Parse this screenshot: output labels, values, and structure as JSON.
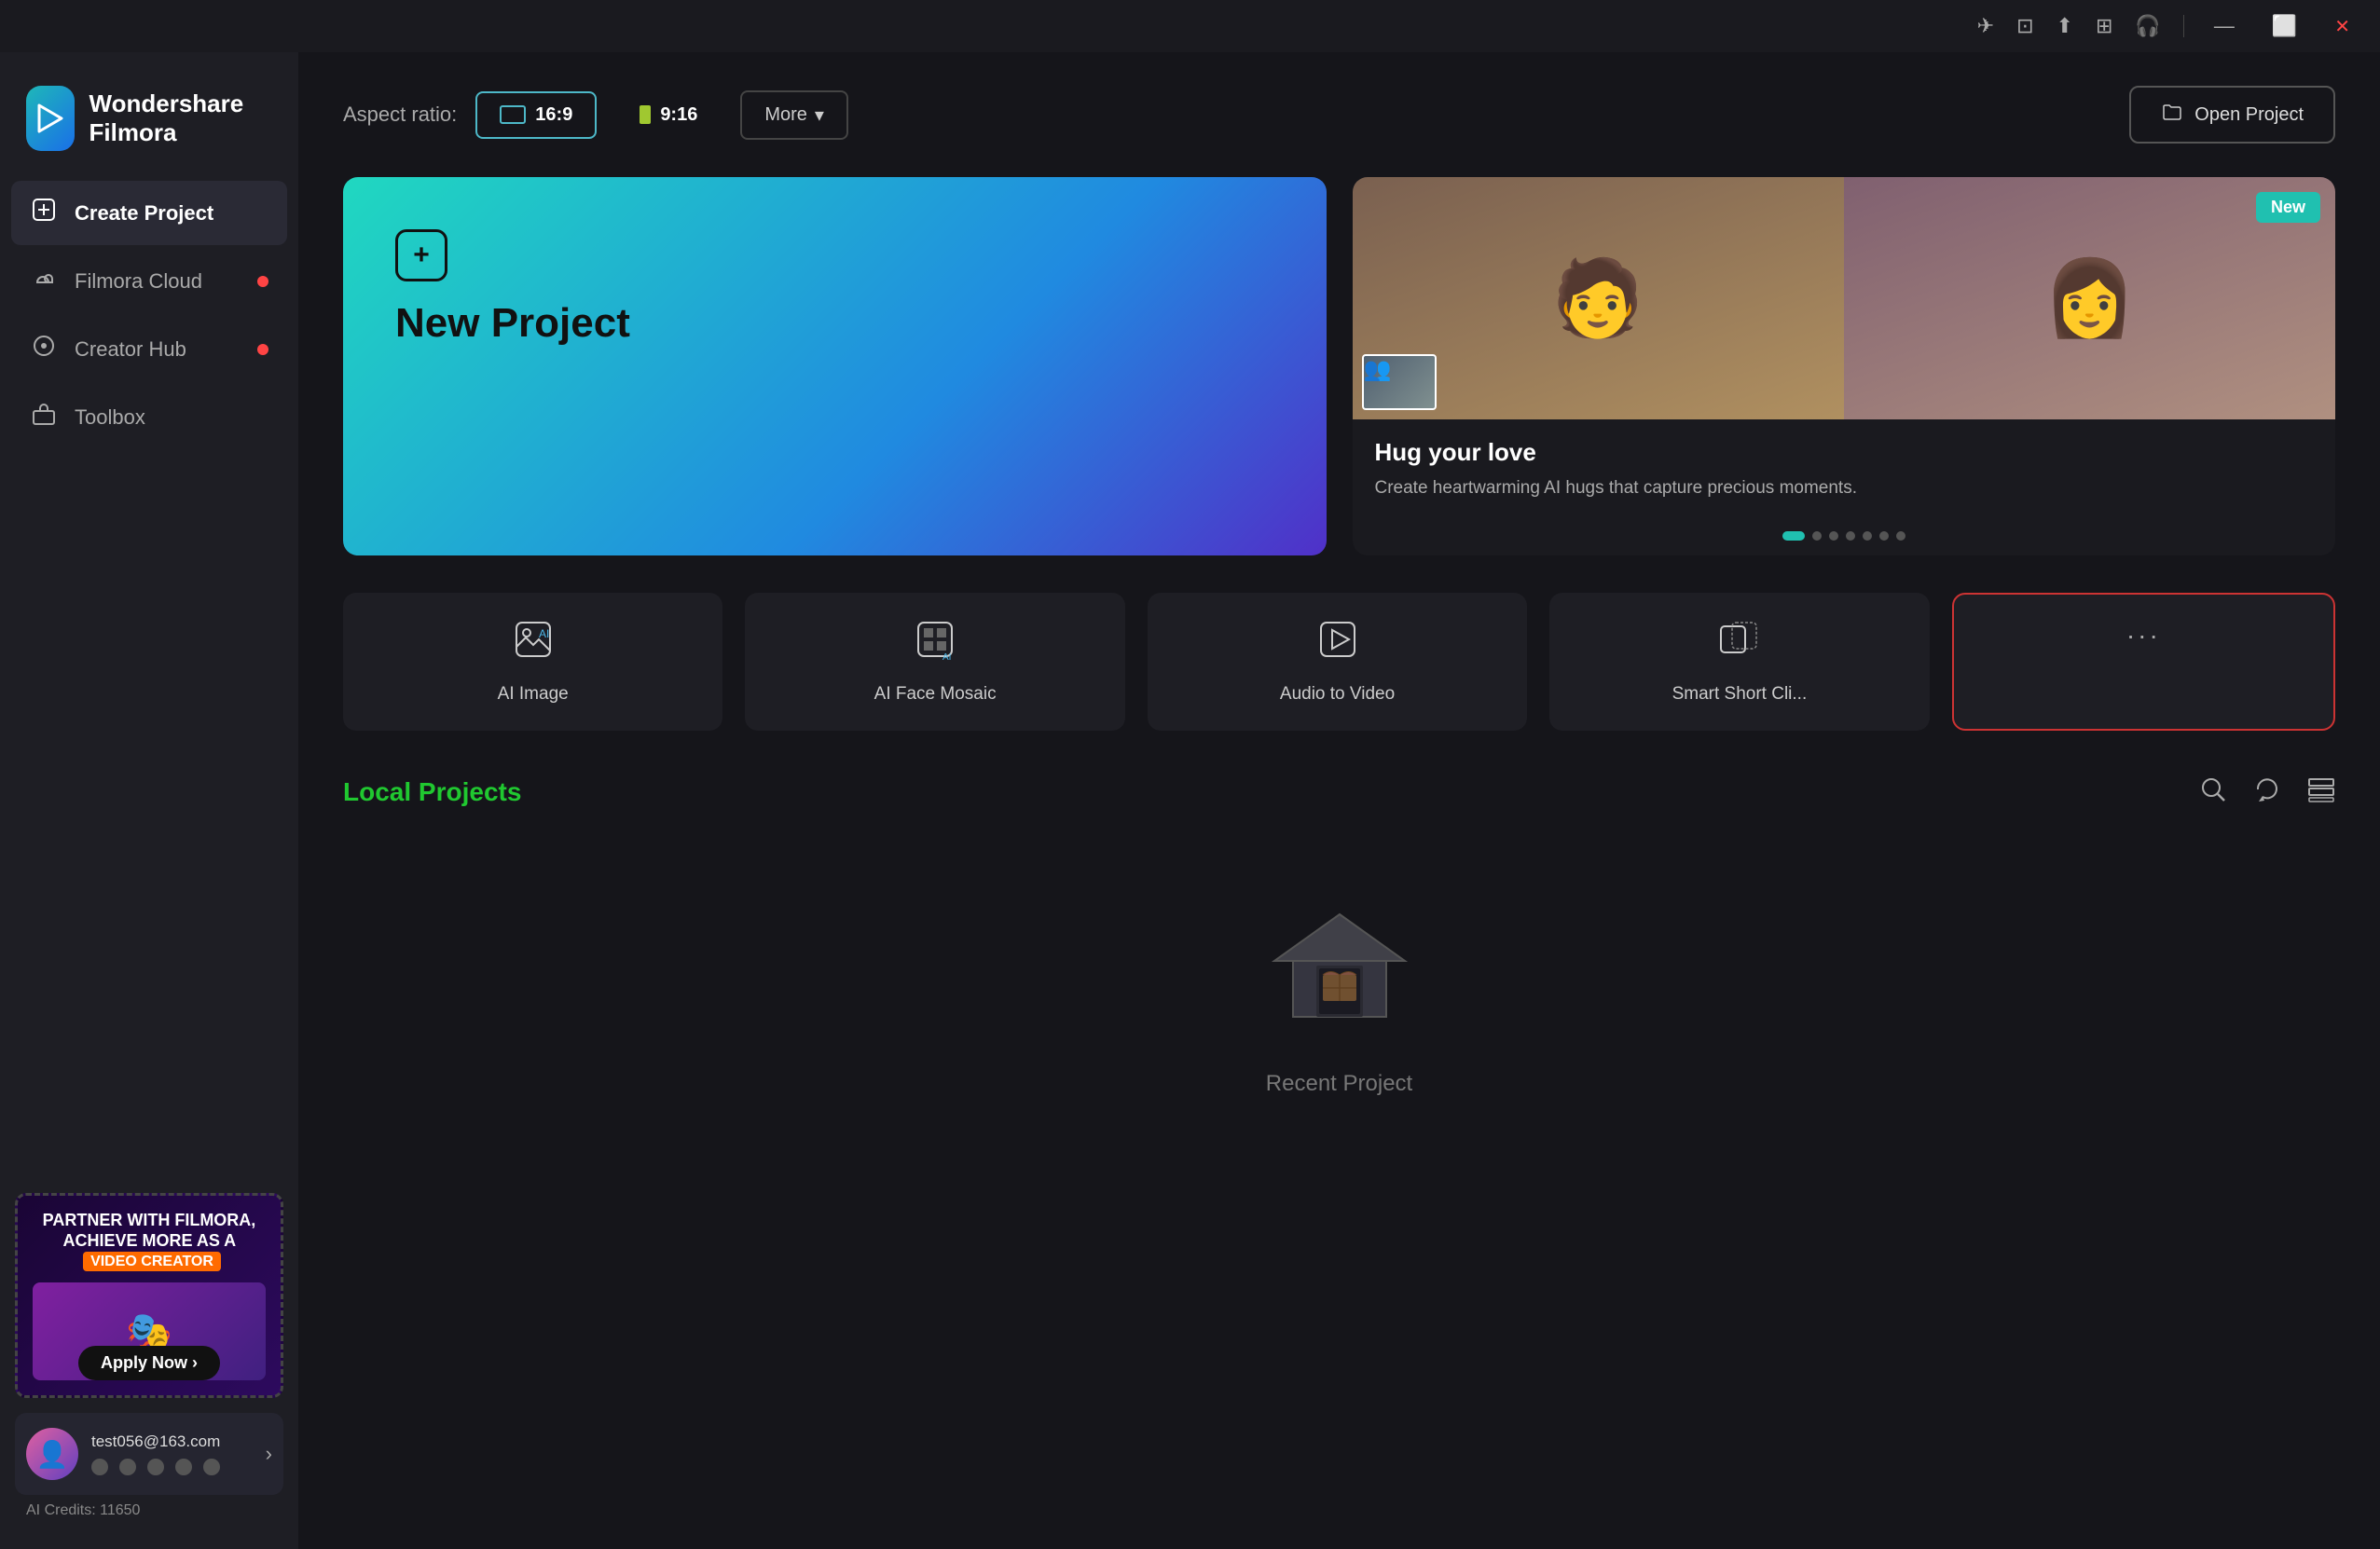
{
  "app": {
    "name": "Wondershare Filmora",
    "logo_symbol": "◈"
  },
  "titlebar": {
    "icons": [
      "✈",
      "⊡",
      "⬆",
      "⊞",
      "🎧"
    ],
    "minimize": "—",
    "maximize": "⬜",
    "close": "✕"
  },
  "sidebar": {
    "nav_items": [
      {
        "id": "create-project",
        "label": "Create Project",
        "icon": "⊞",
        "active": true,
        "dot": false
      },
      {
        "id": "filmora-cloud",
        "label": "Filmora Cloud",
        "icon": "☁",
        "active": false,
        "dot": true
      },
      {
        "id": "creator-hub",
        "label": "Creator Hub",
        "icon": "◎",
        "active": false,
        "dot": true
      },
      {
        "id": "toolbox",
        "label": "Toolbox",
        "icon": "⊡",
        "active": false,
        "dot": false
      }
    ],
    "promo": {
      "line1": "PARTNER WITH FILMORA,",
      "line2": "ACHIEVE MORE AS A",
      "highlight": "VIDEO CREATOR",
      "apply_btn": "Apply Now ›"
    },
    "user": {
      "email": "test056@163.com",
      "credits_label": "AI Credits: 11650"
    }
  },
  "content": {
    "aspect_ratio_label": "Aspect ratio:",
    "aspect_169": "16:9",
    "aspect_916": "9:16",
    "more_label": "More",
    "open_project_label": "Open Project",
    "new_project_label": "New Project",
    "featured": {
      "badge": "New",
      "title": "Hug your love",
      "description": "Create heartwarming AI hugs that capture precious moments."
    },
    "tools": [
      {
        "id": "ai-image",
        "label": "AI Image",
        "icon": "🖼"
      },
      {
        "id": "ai-face-mosaic",
        "label": "AI Face Mosaic",
        "icon": "⊞"
      },
      {
        "id": "audio-to-video",
        "label": "Audio to Video",
        "icon": "▶"
      },
      {
        "id": "smart-short-cli",
        "label": "Smart Short Cli...",
        "icon": "⊡"
      },
      {
        "id": "more-tools",
        "label": "",
        "icon": "···"
      }
    ],
    "local_projects": {
      "title": "Local Projects",
      "empty_label": "Recent Project"
    }
  }
}
